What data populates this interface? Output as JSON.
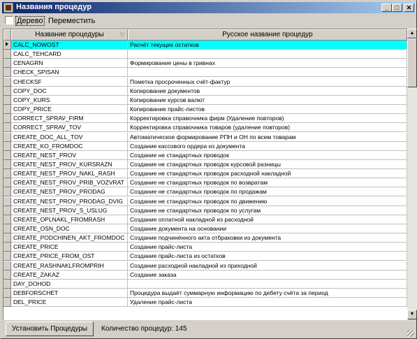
{
  "window": {
    "title": "Названия процедур",
    "minimize": "_",
    "maximize": "□",
    "close": "✕"
  },
  "toolbar": {
    "tree_checkbox_label": "Дерево",
    "move_label": "Переместить",
    "tree_checked": false
  },
  "grid": {
    "columns": [
      "Название процедуры",
      "Русское название процедур"
    ],
    "selected_index": 0,
    "rows": [
      [
        "CALC_NOWOST",
        "Расчёт текущих остатков"
      ],
      [
        "CALC_TEHCARD",
        ""
      ],
      [
        "CENAGRN",
        "Формирование цены в гривнах"
      ],
      [
        "CHECK_SPISAN",
        ""
      ],
      [
        "CHECKSF",
        "Пометка просроченных счёт-фактур"
      ],
      [
        "COPY_DOC",
        "Копирование документов"
      ],
      [
        "COPY_KURS",
        "Копирование курсов валют"
      ],
      [
        "COPY_PRICE",
        "Копирование прайс-листов"
      ],
      [
        "CORRECT_SPRAV_FIRM",
        "Корректировка справочника фирм (Удаление повторов)"
      ],
      [
        "CORRECT_SPRAV_TOV",
        "Корректировка справочника товаров (удаление повторов)"
      ],
      [
        "CREATE_DOC_ALL_TOV",
        "Автоматическое формирование РПН и ОН по всем товарам"
      ],
      [
        "CREATE_KO_FROMDOC",
        "Создание кассового ордера из документа"
      ],
      [
        "CREATE_NEST_PROV",
        "Создание не стандартных проводок"
      ],
      [
        "CREATE_NEST_PROV_KURSRAZN",
        "Создание не стандартных проводок курсовой разницы"
      ],
      [
        "CREATE_NEST_PROV_NAKL_RASH",
        "Создание не стандартных проводок расходной накладной"
      ],
      [
        "CREATE_NEST_PROV_PRIB_VOZVRAT",
        "Создание не стандартных проводок по возвратам"
      ],
      [
        "CREATE_NEST_PROV_PRODAG",
        "Создание не стандартных проводок по продажам"
      ],
      [
        "CREATE_NEST_PROV_PRODAG_DVIG",
        "Создание не стандартных проводок по движению"
      ],
      [
        "CREATE_NEST_PROV_S_USLUG",
        "Создание не стандартных проводок по услугам"
      ],
      [
        "CREATE_OPLNAKL_FROMRASH",
        "Создание оплатной накладной из расходной"
      ],
      [
        "CREATE_OSN_DOC",
        "Создание документа на основании"
      ],
      [
        "CREATE_PODCHINEN_AKT_FROMDOC",
        "Создание подчинённого акта отбраковки из документа"
      ],
      [
        "CREATE_PRICE",
        "Создание прайс-листа"
      ],
      [
        "CREATE_PRICE_FROM_OST",
        "Создание прайс-листа из остатков"
      ],
      [
        "CREATE_RASHNAKLFROMPRIH",
        "Создание расходной накладной из приходной"
      ],
      [
        "CREATE_ZAKAZ",
        "Создание заказа"
      ],
      [
        "DAY_DOHOD",
        ""
      ],
      [
        "DEBFORSCHET",
        "Процедура выдаёт суммарную информацию по дебету счёта за период"
      ],
      [
        "DEL_PRICE",
        "Удаление прайс-листа"
      ]
    ]
  },
  "bottom": {
    "set_button": "Установить Процедуры",
    "count_label": "Количество процедур: 145"
  }
}
